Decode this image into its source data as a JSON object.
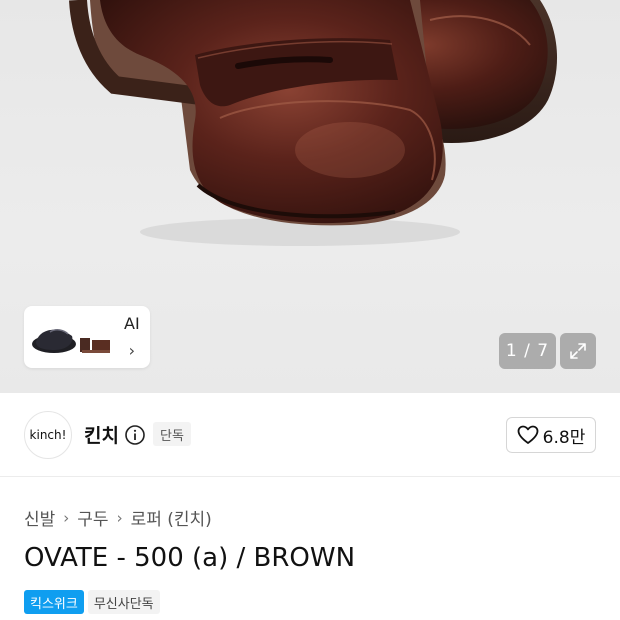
{
  "gallery": {
    "counter": "1 / 7",
    "ai_label": "AI",
    "ai_chevron": "›",
    "expand_icon": "expand-icon"
  },
  "brand": {
    "logo_text": "kinch!",
    "name": "킨치",
    "badge": "단독",
    "likes": "6.8만",
    "like_icon": "heart-icon",
    "info_icon": "info-icon"
  },
  "breadcrumb": {
    "items": [
      "신발",
      "구두",
      "로퍼 (킨치)"
    ],
    "separator": "›"
  },
  "product": {
    "title": "OVATE - 500 (a) / BROWN"
  },
  "tags": {
    "primary": "킥스위크",
    "secondary": "무신사단독"
  },
  "colors": {
    "accent_blue": "#0f9ef0",
    "shoe_brown": "#5a2a1e"
  }
}
